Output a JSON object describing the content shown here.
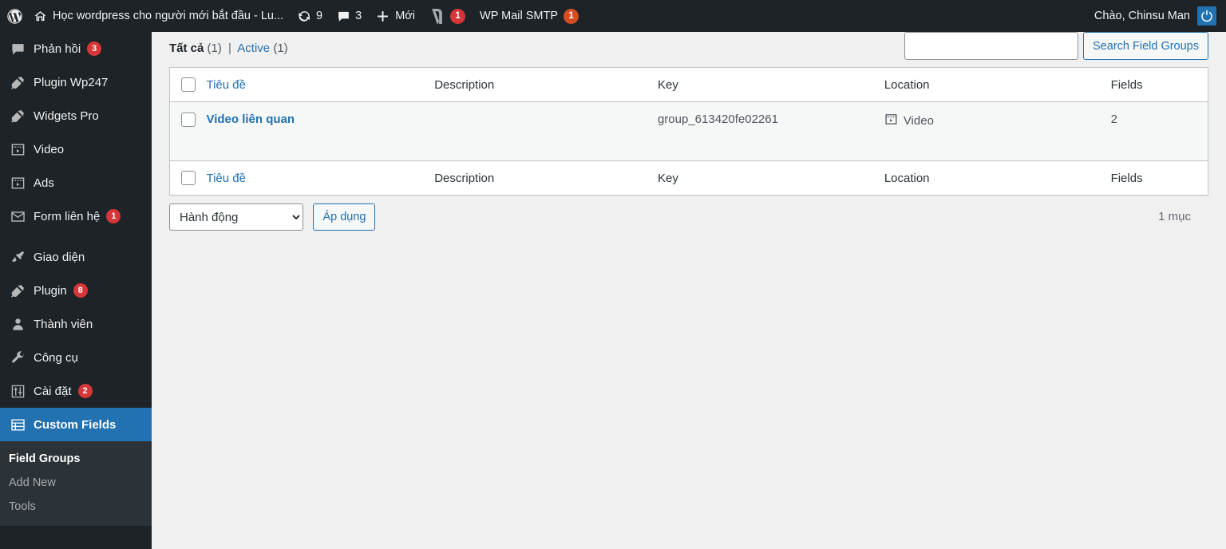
{
  "adminbar": {
    "site_title": "Học wordpress cho người mới bắt đầu - Lu...",
    "updates_count": "9",
    "comments_count": "3",
    "new_label": "Mới",
    "yoast_count": "1",
    "smtp_label": "WP Mail SMTP",
    "smtp_count": "1",
    "howdy": "Chào, Chinsu Man"
  },
  "sidebar": {
    "items": [
      {
        "label": "Phản hồi",
        "icon": "comments-icon",
        "count": "3"
      },
      {
        "label": "Plugin Wp247",
        "icon": "plugin-icon",
        "count": ""
      },
      {
        "label": "Widgets Pro",
        "icon": "plugin-icon",
        "count": ""
      },
      {
        "label": "Video",
        "icon": "video-icon",
        "count": ""
      },
      {
        "label": "Ads",
        "icon": "video-icon",
        "count": ""
      },
      {
        "label": "Form liên hệ",
        "icon": "envelope-icon",
        "count": "1"
      },
      {
        "label": "Giao diện",
        "icon": "appearance-icon",
        "count": ""
      },
      {
        "label": "Plugin",
        "icon": "plugin-icon",
        "count": "8"
      },
      {
        "label": "Thành viên",
        "icon": "users-icon",
        "count": ""
      },
      {
        "label": "Công cụ",
        "icon": "tools-icon",
        "count": ""
      },
      {
        "label": "Cài đặt",
        "icon": "settings-icon",
        "count": "2"
      },
      {
        "label": "Custom Fields",
        "icon": "custom-fields-icon",
        "count": ""
      }
    ],
    "submenu": [
      {
        "label": "Field Groups",
        "current": true
      },
      {
        "label": "Add New",
        "current": false
      },
      {
        "label": "Tools",
        "current": false
      }
    ]
  },
  "filters": {
    "all_label": "Tất cả",
    "all_count": "(1)",
    "separator": "|",
    "active_label": "Active",
    "active_count": "(1)"
  },
  "search": {
    "value": "",
    "placeholder": "",
    "button_label": "Search Field Groups"
  },
  "table": {
    "columns": {
      "title": "Tiêu đề",
      "description": "Description",
      "key": "Key",
      "location": "Location",
      "fields": "Fields"
    },
    "rows": [
      {
        "title": "Video liên quan",
        "description": "",
        "key": "group_613420fe02261",
        "location": "Video",
        "location_icon": "video-icon",
        "fields": "2"
      }
    ]
  },
  "bottom_nav": {
    "bulk_action_selected": "Hành động",
    "bulk_action_options": [
      "Hành động"
    ],
    "apply_label": "Áp dụng",
    "displaying_num": "1 mục"
  },
  "colors": {
    "admin_dark": "#1d2327",
    "submenu_dark": "#2c3338",
    "accent_blue": "#2271b1",
    "badge_red": "#d63638",
    "badge_orange": "#d54e21",
    "page_bg": "#f0f0f1"
  }
}
